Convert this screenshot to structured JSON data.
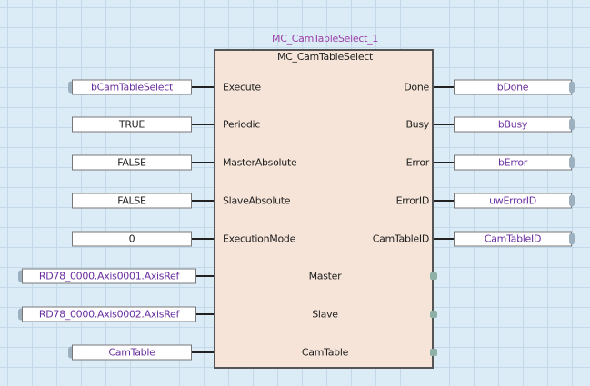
{
  "function_block": {
    "instance_name": "MC_CamTableSelect_1",
    "type_name": "MC_CamTableSelect",
    "inputs": [
      {
        "pin": "Execute",
        "variable": "bCamTableSelect",
        "kind": "variable"
      },
      {
        "pin": "Periodic",
        "variable": "TRUE",
        "kind": "constant"
      },
      {
        "pin": "MasterAbsolute",
        "variable": "FALSE",
        "kind": "constant"
      },
      {
        "pin": "SlaveAbsolute",
        "variable": "FALSE",
        "kind": "constant"
      },
      {
        "pin": "ExecutionMode",
        "variable": "0",
        "kind": "constant"
      }
    ],
    "outputs": [
      {
        "pin": "Done",
        "variable": "bDone"
      },
      {
        "pin": "Busy",
        "variable": "bBusy"
      },
      {
        "pin": "Error",
        "variable": "bError"
      },
      {
        "pin": "ErrorID",
        "variable": "uwErrorID"
      },
      {
        "pin": "CamTableID",
        "variable": "CamTableID"
      }
    ],
    "in_outs": [
      {
        "pin": "Master",
        "variable": "RD78_0000.Axis0001.AxisRef"
      },
      {
        "pin": "Slave",
        "variable": "RD78_0000.Axis0002.AxisRef"
      },
      {
        "pin": "CamTable",
        "variable": "CamTable"
      }
    ]
  },
  "colors": {
    "grid_background": "#dcecf7",
    "block_fill": "#f6e4d8",
    "instance_text": "#9b3fa8",
    "variable_text": "#6a2fa0"
  }
}
